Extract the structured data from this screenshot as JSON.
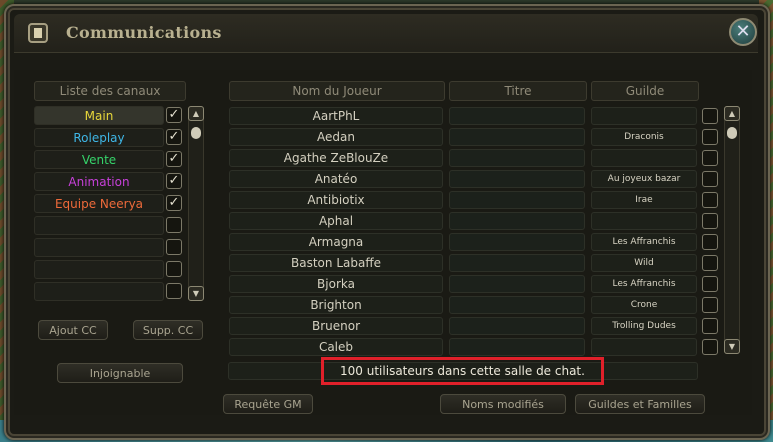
{
  "window": {
    "title": "Communications",
    "close_icon": "close-x-icon"
  },
  "channels": {
    "header": "Liste des canaux",
    "items": [
      {
        "label": "Main",
        "color": "#e6d63a",
        "checked": true,
        "selected": true
      },
      {
        "label": "Roleplay",
        "color": "#3fb6e6",
        "checked": true,
        "selected": false
      },
      {
        "label": "Vente",
        "color": "#35d36a",
        "checked": true,
        "selected": false
      },
      {
        "label": "Animation",
        "color": "#c640d8",
        "checked": true,
        "selected": false
      },
      {
        "label": "Equipe Neerya",
        "color": "#ee6a3a",
        "checked": true,
        "selected": false
      },
      {
        "label": "",
        "checked": false
      },
      {
        "label": "",
        "checked": false
      },
      {
        "label": "",
        "checked": false
      },
      {
        "label": "",
        "checked": false
      }
    ],
    "buttons": {
      "add": "Ajout CC",
      "remove": "Supp. CC",
      "away": "Injoignable"
    }
  },
  "players": {
    "headers": {
      "name": "Nom du Joueur",
      "title": "Titre",
      "guild": "Guilde"
    },
    "rows": [
      {
        "name": "AartPhL",
        "title": "",
        "guild": ""
      },
      {
        "name": "Aedan",
        "title": "",
        "guild": "Draconis"
      },
      {
        "name": "Agathe ZeBlouZe",
        "title": "",
        "guild": ""
      },
      {
        "name": "Anatéo",
        "title": "",
        "guild": "Au joyeux bazar"
      },
      {
        "name": "Antibiotix",
        "title": "",
        "guild": "Irae"
      },
      {
        "name": "Aphal",
        "title": "",
        "guild": ""
      },
      {
        "name": "Armagna",
        "title": "",
        "guild": "Les Affranchis"
      },
      {
        "name": "Baston Labaffe",
        "title": "",
        "guild": "Wild"
      },
      {
        "name": "Bjorka",
        "title": "",
        "guild": "Les Affranchis"
      },
      {
        "name": "Brighton",
        "title": "",
        "guild": "Crone"
      },
      {
        "name": "Bruenor",
        "title": "",
        "guild": "Trolling Dudes"
      },
      {
        "name": "Caleb",
        "title": "",
        "guild": ""
      }
    ],
    "status": "100 utilisateurs dans cette salle de chat."
  },
  "bottom_buttons": {
    "gm": "Requête GM",
    "modified_names": "Noms modifiés",
    "guilds": "Guildes et Familles"
  }
}
